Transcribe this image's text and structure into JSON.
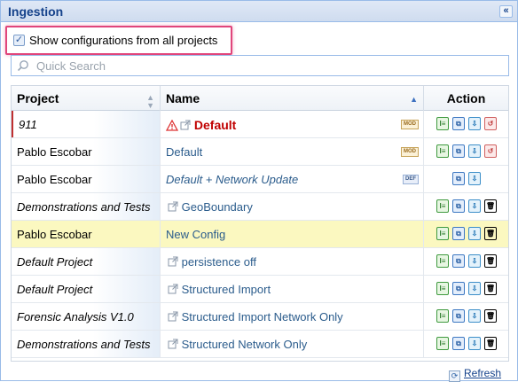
{
  "panel": {
    "title": "Ingestion"
  },
  "show_all": {
    "label": "Show configurations from all projects",
    "checked": true
  },
  "search": {
    "placeholder": "Quick Search",
    "value": ""
  },
  "grid": {
    "columns": {
      "project": "Project",
      "name": "Name",
      "action": "Action"
    },
    "rows": [
      {
        "project": "911",
        "name": "Default",
        "project_italic": true,
        "name_style": "bold-red",
        "warning": true,
        "external": true,
        "badge": "MOD",
        "actions": [
          "edit",
          "copy",
          "export",
          "reset"
        ],
        "selected": false
      },
      {
        "project": "Pablo Escobar",
        "name": "Default",
        "project_italic": false,
        "name_style": "normal",
        "warning": false,
        "external": false,
        "badge": "MOD",
        "actions": [
          "edit",
          "copy",
          "export",
          "reset"
        ],
        "selected": false
      },
      {
        "project": "Pablo Escobar",
        "name": "Default + Network Update",
        "project_italic": false,
        "name_style": "italic",
        "warning": false,
        "external": false,
        "badge": "DEF",
        "actions": [
          "copy",
          "export"
        ],
        "selected": false
      },
      {
        "project": "Demonstrations and Tests",
        "name": "GeoBoundary",
        "project_italic": true,
        "name_style": "normal",
        "warning": false,
        "external": true,
        "badge": "",
        "actions": [
          "edit",
          "copy",
          "export",
          "delete"
        ],
        "selected": false
      },
      {
        "project": "Pablo Escobar",
        "name": "New Config",
        "project_italic": false,
        "name_style": "normal",
        "warning": false,
        "external": false,
        "badge": "",
        "actions": [
          "edit",
          "copy",
          "export",
          "delete"
        ],
        "selected": true
      },
      {
        "project": "Default Project",
        "name": "persistence off",
        "project_italic": true,
        "name_style": "normal",
        "warning": false,
        "external": true,
        "badge": "",
        "actions": [
          "edit",
          "copy",
          "export",
          "delete"
        ],
        "selected": false
      },
      {
        "project": "Default Project",
        "name": "Structured Import",
        "project_italic": true,
        "name_style": "normal",
        "warning": false,
        "external": true,
        "badge": "",
        "actions": [
          "edit",
          "copy",
          "export",
          "delete"
        ],
        "selected": false
      },
      {
        "project": "Forensic Analysis V1.0",
        "name": "Structured Import Network Only",
        "project_italic": true,
        "name_style": "normal",
        "warning": false,
        "external": true,
        "badge": "",
        "actions": [
          "edit",
          "copy",
          "export",
          "delete"
        ],
        "selected": false
      },
      {
        "project": "Demonstrations and Tests",
        "name": "Structured Network Only",
        "project_italic": true,
        "name_style": "normal",
        "warning": false,
        "external": true,
        "badge": "",
        "actions": [
          "edit",
          "copy",
          "export",
          "delete"
        ],
        "selected": false
      }
    ]
  },
  "refresh": {
    "label": "Refresh"
  },
  "colors": {
    "accent": "#15428b",
    "highlight_border": "#e0457b",
    "selected_row": "#fbf8c0",
    "name_link": "#2b5c8c",
    "warning_red": "#c00000"
  }
}
